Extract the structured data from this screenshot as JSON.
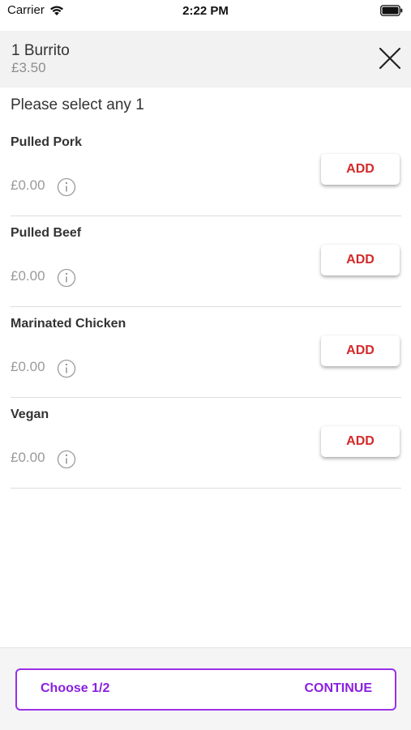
{
  "status_bar": {
    "carrier": "Carrier",
    "time": "2:22 PM"
  },
  "header": {
    "title": "1 Burrito",
    "price": "£3.50",
    "close_icon": "close-icon"
  },
  "prompt": "Please select any 1",
  "options": [
    {
      "name": "Pulled Pork",
      "price": "£0.00",
      "add_label": "ADD"
    },
    {
      "name": "Pulled Beef",
      "price": "£0.00",
      "add_label": "ADD"
    },
    {
      "name": "Marinated Chicken",
      "price": "£0.00",
      "add_label": "ADD"
    },
    {
      "name": "Vegan",
      "price": "£0.00",
      "add_label": "ADD"
    }
  ],
  "footer": {
    "choose_label": "Choose 1/2",
    "continue_label": "CONTINUE"
  },
  "colors": {
    "accent_purple": "#8a1fe0",
    "add_red": "#d12a2a",
    "header_bg": "#f2f2f2"
  }
}
